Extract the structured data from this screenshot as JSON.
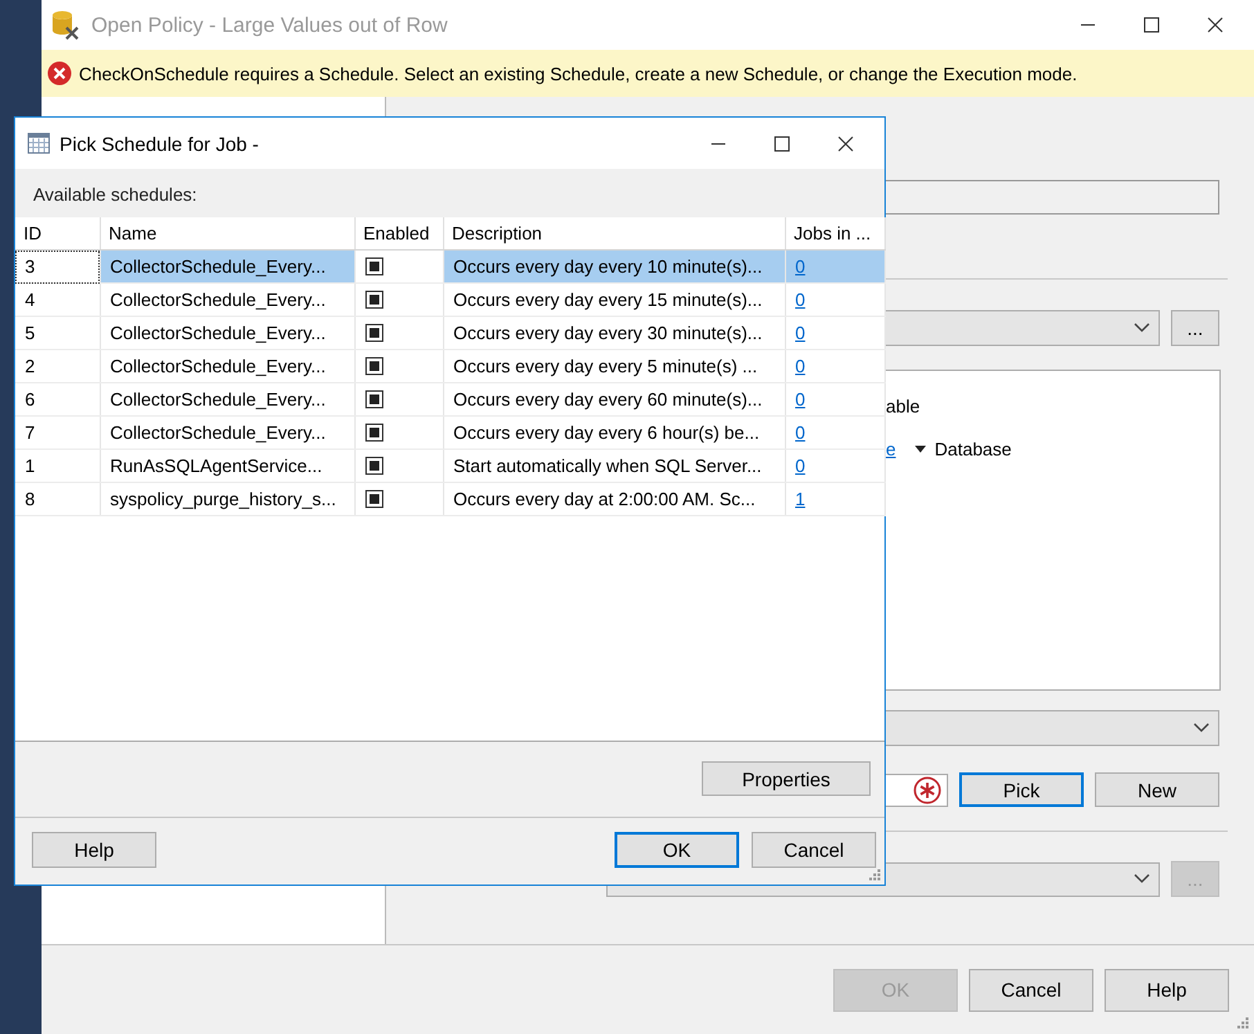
{
  "window": {
    "title": "Open Policy - Large Values out of Row"
  },
  "error_bar": {
    "message": "CheckOnSchedule requires a Schedule. Select an existing Schedule, create a new Schedule, or change the Execution mode."
  },
  "form": {
    "condition_text": "able",
    "condition_link": "e",
    "target": "Database",
    "schedule_buttons": [
      {
        "label": "Pick",
        "focused": true
      },
      {
        "label": "New",
        "focused": false
      }
    ],
    "browse_buttons": [
      {
        "label": "...",
        "disabled": false
      },
      {
        "label": "...",
        "disabled": true
      }
    ]
  },
  "footer_buttons": [
    {
      "label": "OK",
      "disabled": true
    },
    {
      "label": "Cancel",
      "disabled": false
    },
    {
      "label": "Help",
      "disabled": false
    }
  ],
  "dialog": {
    "title": "Pick Schedule for Job -",
    "list_label": "Available schedules:",
    "columns": [
      "ID",
      "Name",
      "Enabled",
      "Description",
      "Jobs in ..."
    ],
    "rows": [
      {
        "id": "3",
        "name": "CollectorSchedule_Every...",
        "enabled": true,
        "description": "Occurs every day every 10 minute(s)...",
        "jobs": "0",
        "selected": true
      },
      {
        "id": "4",
        "name": "CollectorSchedule_Every...",
        "enabled": true,
        "description": "Occurs every day every 15 minute(s)...",
        "jobs": "0",
        "selected": false
      },
      {
        "id": "5",
        "name": "CollectorSchedule_Every...",
        "enabled": true,
        "description": "Occurs every day every 30 minute(s)...",
        "jobs": "0",
        "selected": false
      },
      {
        "id": "2",
        "name": "CollectorSchedule_Every...",
        "enabled": true,
        "description": "Occurs every day every 5 minute(s) ...",
        "jobs": "0",
        "selected": false
      },
      {
        "id": "6",
        "name": "CollectorSchedule_Every...",
        "enabled": true,
        "description": "Occurs every day every 60 minute(s)...",
        "jobs": "0",
        "selected": false
      },
      {
        "id": "7",
        "name": "CollectorSchedule_Every...",
        "enabled": true,
        "description": "Occurs every day every 6 hour(s) be...",
        "jobs": "0",
        "selected": false
      },
      {
        "id": "1",
        "name": "RunAsSQLAgentService...",
        "enabled": true,
        "description": "Start automatically when SQL Server...",
        "jobs": "0",
        "selected": false
      },
      {
        "id": "8",
        "name": "syspolicy_purge_history_s...",
        "enabled": true,
        "description": "Occurs every day at 2:00:00 AM. Sc...",
        "jobs": "1",
        "selected": false
      }
    ],
    "properties_button": "Properties",
    "buttons": [
      {
        "label": "Help",
        "default": false
      },
      {
        "label": "OK",
        "default": true
      },
      {
        "label": "Cancel",
        "default": false
      }
    ]
  }
}
